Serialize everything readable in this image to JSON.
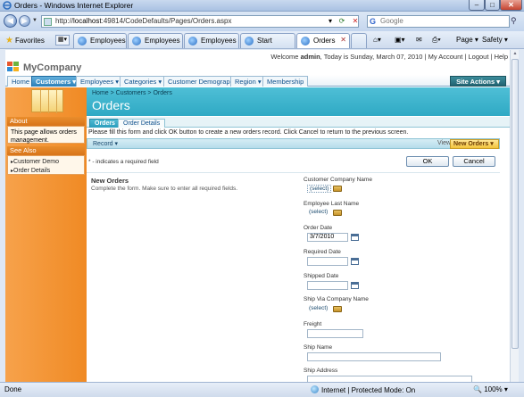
{
  "window": {
    "title": "Orders - Windows Internet Explorer"
  },
  "address": {
    "url_prefix": "http://",
    "url_host": "localhost",
    "url_path": ":49814/CodeDefaults/Pages/Orders.aspx",
    "search_placeholder": "Google"
  },
  "favorites_label": "Favorites",
  "tabs": [
    {
      "label": "Employees"
    },
    {
      "label": "Employees"
    },
    {
      "label": "Employees"
    },
    {
      "label": "Start"
    },
    {
      "label": "Orders",
      "active": true
    }
  ],
  "commands": {
    "page": "Page",
    "safety": "Safety"
  },
  "site": {
    "brand": "MyCompany",
    "welcome_prefix": "Welcome ",
    "user": "admin",
    "welcome_suffix": ", Today is Sunday, March 07, 2010 | ",
    "my_account": "My Account",
    "logout": "Logout",
    "help": "Help",
    "sep1": " | ",
    "sep2": " | "
  },
  "menu": [
    {
      "label": "Home"
    },
    {
      "label": "Customers",
      "active": true
    },
    {
      "label": "Employees"
    },
    {
      "label": "Categories"
    },
    {
      "label": "Customer Demographics"
    },
    {
      "label": "Region"
    },
    {
      "label": "Membership"
    }
  ],
  "site_actions": "Site Actions",
  "sidebar": {
    "about_title": "About",
    "about_text": "This page allows orders management.",
    "see_also_title": "See Also",
    "links": [
      "Customer Demo",
      "Order Details"
    ]
  },
  "breadcrumb": "Home  >  Customers  >  Orders",
  "page_title": "Orders",
  "form_tabs": [
    "Orders",
    "Order Details"
  ],
  "description": "Please fill this form and click OK button to create a new orders record. Click Cancel to return to the previous screen.",
  "record_label": "Record",
  "view_label": "View:",
  "view_value": "New Orders",
  "required_note": "* - indicates a required field",
  "ok_label": "OK",
  "cancel_label": "Cancel",
  "section": {
    "title": "New Orders",
    "description": "Complete the form. Make sure to enter all required fields."
  },
  "fields": {
    "customer_company_name": {
      "label": "Customer Company Name",
      "value": "(select)"
    },
    "employee_last_name": {
      "label": "Employee Last Name",
      "value": "(select)"
    },
    "order_date": {
      "label": "Order Date",
      "value": "3/7/2010"
    },
    "required_date": {
      "label": "Required Date",
      "value": ""
    },
    "shipped_date": {
      "label": "Shipped Date",
      "value": ""
    },
    "ship_via_company_name": {
      "label": "Ship Via Company Name",
      "value": "(select)"
    },
    "freight": {
      "label": "Freight",
      "value": ""
    },
    "ship_name": {
      "label": "Ship Name",
      "value": ""
    },
    "ship_address": {
      "label": "Ship Address",
      "value": ""
    }
  },
  "status": {
    "done": "Done",
    "zone": "Internet | Protected Mode: On",
    "zoom": "100%"
  }
}
